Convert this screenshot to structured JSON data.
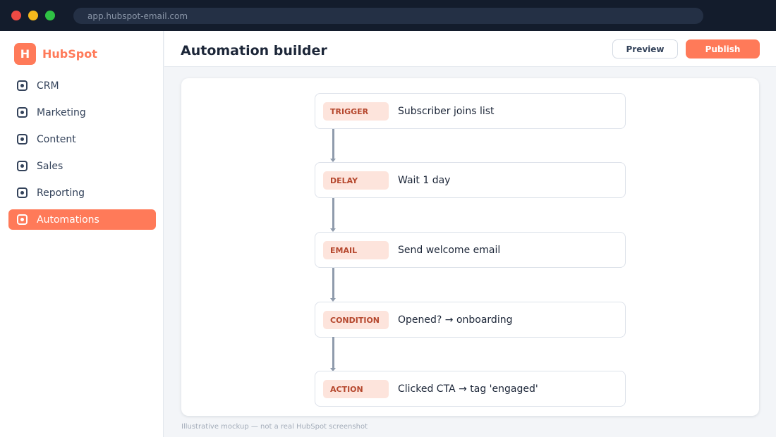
{
  "browser": {
    "url": "app.hubspot-email.com"
  },
  "brand": {
    "logo_letter": "H",
    "name": "HubSpot",
    "color": "#ff7a59"
  },
  "sidebar": {
    "items": [
      {
        "label": "CRM",
        "active": false
      },
      {
        "label": "Marketing",
        "active": false
      },
      {
        "label": "Content",
        "active": false
      },
      {
        "label": "Sales",
        "active": false
      },
      {
        "label": "Reporting",
        "active": false
      },
      {
        "label": "Automations",
        "active": true
      }
    ]
  },
  "header": {
    "title": "Automation builder",
    "preview_label": "Preview",
    "publish_label": "Publish"
  },
  "workflow": {
    "steps": [
      {
        "type": "TRIGGER",
        "text": "Subscriber joins list"
      },
      {
        "type": "DELAY",
        "text": "Wait 1 day"
      },
      {
        "type": "EMAIL",
        "text": "Send welcome email"
      },
      {
        "type": "CONDITION",
        "text": "Opened? → onboarding"
      },
      {
        "type": "ACTION",
        "text": "Clicked CTA → tag 'engaged'"
      }
    ]
  },
  "footnote": "Illustrative mockup — not a real HubSpot screenshot"
}
